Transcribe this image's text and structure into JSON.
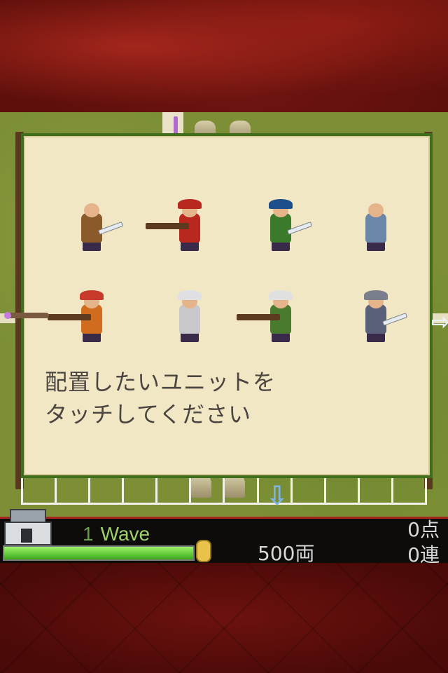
{
  "prompt": {
    "line1": "配置したいユニットを",
    "line2": "タッチしてください"
  },
  "units": [
    {
      "name": "samurai-swordsman",
      "color": "#8b5a2b",
      "hat": "none",
      "weapon": "sword"
    },
    {
      "name": "red-gunner",
      "color": "#b8281e",
      "hat": "#b8281e",
      "weapon": "gun"
    },
    {
      "name": "spear-ashigaru",
      "color": "#3a7a2a",
      "hat": "#1d4f8a",
      "weapon": "sword"
    },
    {
      "name": "monk-fighter",
      "color": "#6b86a8",
      "hat": "none",
      "weapon": "none"
    },
    {
      "name": "red-haired-spearman",
      "color": "#d16b1e",
      "hat": "#c73a2c",
      "weapon": "gun"
    },
    {
      "name": "armored-general",
      "color": "#c8c8cc",
      "hat": "#dfdfe4",
      "weapon": "none"
    },
    {
      "name": "bazooka-veteran",
      "color": "#4a7a2e",
      "hat": "#e0e0e0",
      "weapon": "gun"
    },
    {
      "name": "ninja",
      "color": "#5a5f7a",
      "hat": "#7a7f8e",
      "weapon": "sword"
    }
  ],
  "hud": {
    "wave_number": "1",
    "wave_label": "Wave",
    "hp_fraction": 1.0,
    "money": "500両",
    "score": "0点",
    "combo": "0連"
  },
  "icons": {
    "castle": "castle-icon",
    "coin": "coin-icon",
    "right_arrow": "arrow-right-icon",
    "down_arrow": "arrow-down-icon"
  },
  "colors": {
    "panel_bg": "#f2e7c4",
    "panel_border": "#3f6f1d",
    "hp_fill": "#3aa81a",
    "wave_text": "#9fd16a",
    "hud_border": "#a8251c"
  }
}
